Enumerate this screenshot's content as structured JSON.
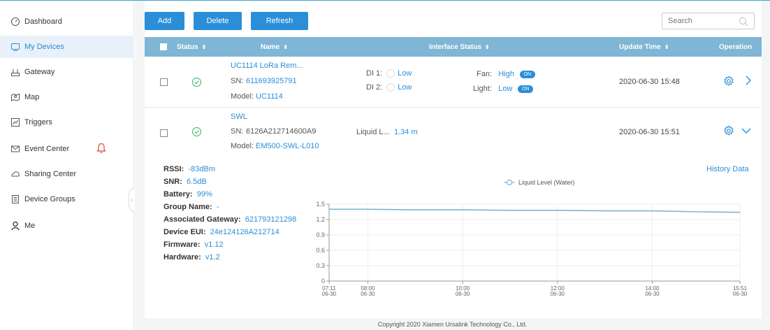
{
  "sidebar": {
    "items": [
      {
        "label": "Dashboard",
        "icon": "dashboard-icon"
      },
      {
        "label": "My Devices",
        "icon": "devices-icon",
        "active": true
      },
      {
        "label": "Gateway",
        "icon": "gateway-icon"
      },
      {
        "label": "Map",
        "icon": "map-icon"
      },
      {
        "label": "Triggers",
        "icon": "triggers-icon"
      },
      {
        "label": "Event Center",
        "icon": "event-center-icon"
      },
      {
        "label": "Sharing Center",
        "icon": "sharing-center-icon"
      },
      {
        "label": "Device Groups",
        "icon": "device-groups-icon"
      },
      {
        "label": "Me",
        "icon": "user-icon"
      }
    ]
  },
  "toolbar": {
    "add": "Add",
    "delete": "Delete",
    "refresh": "Refresh",
    "search_placeholder": "Search"
  },
  "table": {
    "headers": {
      "status": "Status",
      "name": "Name",
      "interface": "Interface Status",
      "update": "Update Time",
      "operation": "Operation"
    },
    "rows": [
      {
        "name": "UC1114 LoRa Rem...",
        "sn_label": "SN:",
        "sn": "611693925791",
        "model_label": "Model:",
        "model": "UC1114",
        "di1_label": "DI 1:",
        "di1_value": "Low",
        "di2_label": "DI 2:",
        "di2_value": "Low",
        "fan_label": "Fan:",
        "fan_value": "High",
        "light_label": "Light:",
        "light_value": "Low",
        "toggle_text": "ON",
        "update_time": "2020-06-30 15:48"
      },
      {
        "name": "SWL",
        "sn_label": "SN:",
        "sn": "6126A212714600A9",
        "model_label": "Model:",
        "model": "EM500-SWL-L010",
        "interface_label": "Liquid L...",
        "interface_value": "1.34 m",
        "update_time": "2020-06-30 15:51"
      }
    ]
  },
  "detail": {
    "rssi_label": "RSSI:",
    "rssi": "-83dBm",
    "snr_label": "SNR:",
    "snr": "6.5dB",
    "battery_label": "Battery:",
    "battery": "99%",
    "group_label": "Group Name:",
    "group": "-",
    "gateway_label": "Associated Gateway:",
    "gateway": "621793121298",
    "eui_label": "Device EUI:",
    "eui": "24e124126A212714",
    "firmware_label": "Firmware:",
    "firmware": "v1.12",
    "hardware_label": "Hardware:",
    "hardware": "v1.2",
    "history_link": "History Data"
  },
  "chart_data": {
    "type": "line",
    "legend": "Liquid Level (Water)",
    "legend_position": "top-center",
    "ylim": [
      0,
      1.5
    ],
    "yticks": [
      "0",
      "0.3",
      "0.6",
      "0.9",
      "1.2",
      "1.5"
    ],
    "xlim_hours": [
      7.1833,
      15.85
    ],
    "xticks": [
      {
        "time": "07:11",
        "date": "06-30",
        "h": 7.1833
      },
      {
        "time": "08:00",
        "date": "06-30",
        "h": 8.0
      },
      {
        "time": "10:00",
        "date": "06-30",
        "h": 10.0
      },
      {
        "time": "12:00",
        "date": "06-30",
        "h": 12.0
      },
      {
        "time": "14:00",
        "date": "06-30",
        "h": 14.0
      },
      {
        "time": "15:51",
        "date": "06-30",
        "h": 15.85
      }
    ],
    "series": [
      {
        "name": "Liquid Level (Water)",
        "color": "#7fb5d5",
        "x": [
          7.1833,
          8.0,
          9.0,
          10.0,
          11.0,
          12.0,
          13.0,
          14.0,
          15.0,
          15.85
        ],
        "y": [
          1.4,
          1.4,
          1.39,
          1.39,
          1.38,
          1.38,
          1.37,
          1.37,
          1.35,
          1.34
        ]
      }
    ],
    "grid": true
  },
  "footer": "Copyright 2020 Xiamen Ursalink Technology Co., Ltd."
}
